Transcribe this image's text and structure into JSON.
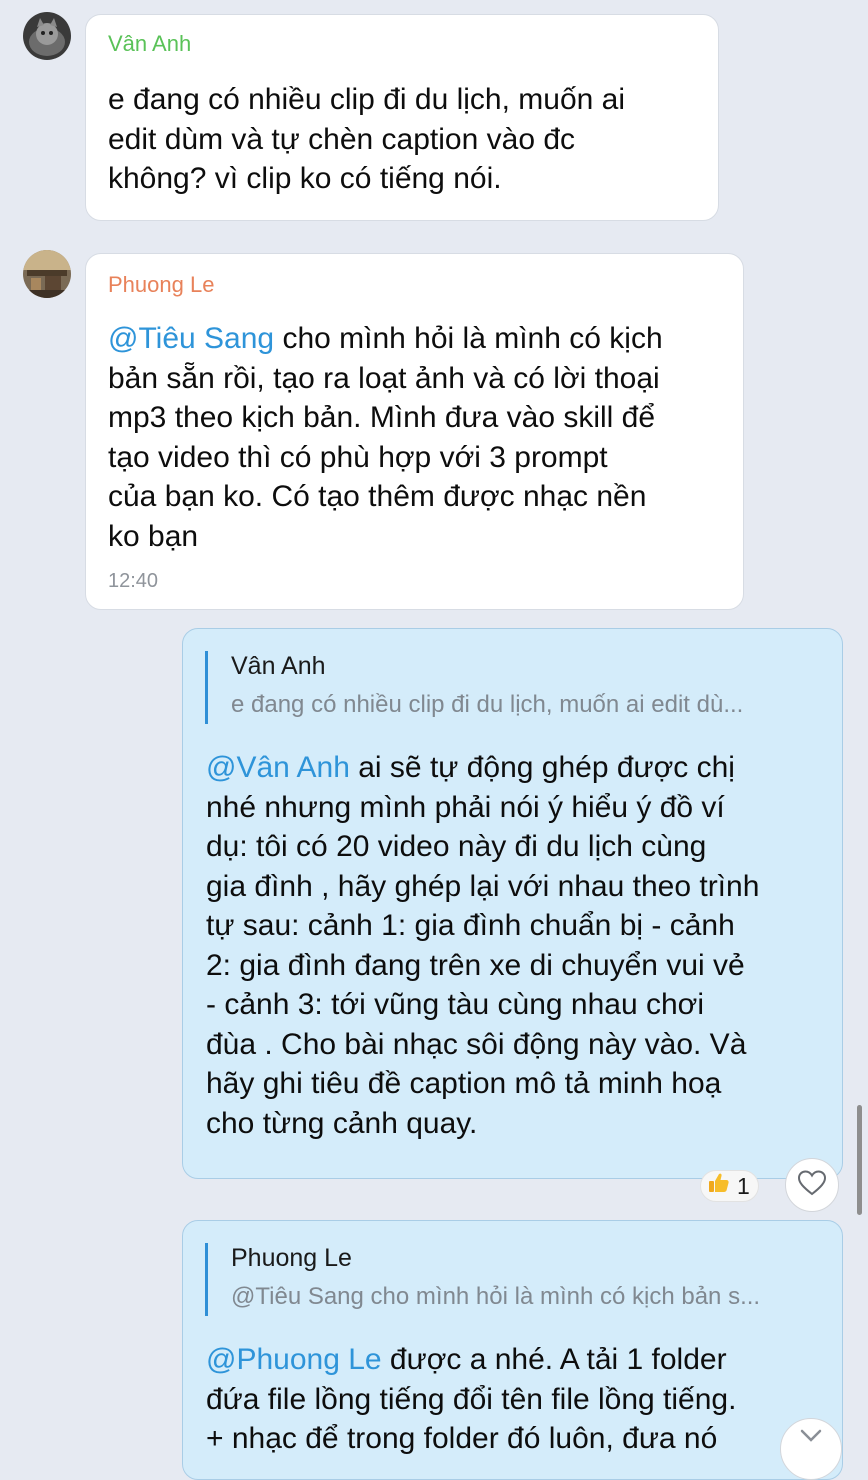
{
  "messages": [
    {
      "sender": "Vân Anh",
      "sender_color": "#5ac258",
      "lines": [
        "e đang có nhiều clip đi du lịch, muốn ai",
        "edit dùm và tự chèn caption vào đc",
        "không? vì clip ko có tiếng nói."
      ]
    },
    {
      "sender": "Phuong Le",
      "sender_color": "#e8825a",
      "mention": "@Tiêu Sang",
      "first_line_rest": " cho mình hỏi là mình có kịch",
      "lines": [
        "bản sẵn rồi, tạo ra loạt ảnh và có lời thoại",
        "mp3 theo kịch bản. Mình đưa vào skill để",
        "tạo video thì có phù hợp với 3 prompt",
        "của bạn ko. Có tạo thêm được nhạc nền",
        "ko bạn"
      ],
      "time": "12:40"
    },
    {
      "quote_author": "Vân Anh",
      "quote_text": "e đang có nhiều clip đi du lịch, muốn ai edit dù...",
      "mention": "@Vân Anh",
      "first_line_rest": " ai sẽ tự động ghép được chị",
      "lines": [
        "nhé nhưng mình phải nói ý hiểu ý đồ ví",
        "dụ: tôi có 20 video này đi du lịch cùng",
        "gia đình , hãy ghép lại với nhau theo trình",
        "tự sau: cảnh 1: gia đình chuẩn bị - cảnh",
        "2: gia đình đang trên xe di chuyển vui vẻ",
        "- cảnh 3: tới vũng tàu cùng nhau chơi",
        "đùa . Cho bài nhạc sôi động này vào. Và",
        "hãy ghi tiêu đề caption mô tả minh hoạ",
        "cho từng cảnh quay."
      ],
      "reaction_icon": "thumbs-up-icon",
      "reaction_count": "1"
    },
    {
      "quote_author": "Phuong Le",
      "quote_text": "@Tiêu Sang cho mình hỏi là mình có kịch bản s...",
      "mention": "@Phuong Le",
      "first_line_rest": " được a nhé. A tải 1 folder",
      "lines": [
        "đứa file lồng tiếng đổi tên file lồng tiếng.",
        "+ nhạc để trong folder đó luôn, đưa nó"
      ]
    }
  ],
  "colors": {
    "background": "#e6eaf2",
    "incoming_bubble": "#ffffff",
    "outgoing_bubble": "#d4ecfa",
    "mention": "#2e94d9",
    "quote_bar": "#2f8fd6"
  }
}
